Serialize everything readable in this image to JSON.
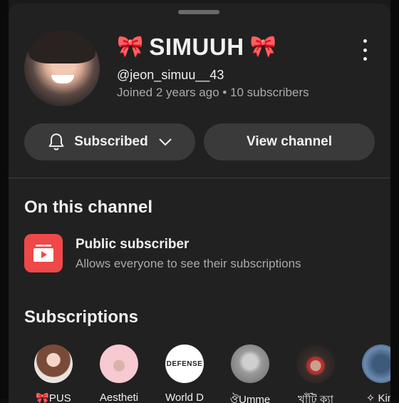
{
  "channel": {
    "bow_glyph": "🎀",
    "name": "SIMUUH",
    "handle": "@jeon_simuu__43",
    "meta": "Joined 2 years ago • 10 subscribers"
  },
  "buttons": {
    "subscribed": "Subscribed",
    "view_channel": "View channel"
  },
  "on_this_channel": {
    "title": "On this channel",
    "item_title": "Public subscriber",
    "item_desc": "Allows everyone to see their subscriptions"
  },
  "subscriptions": {
    "title": "Subscriptions",
    "items": [
      {
        "name": "🎀PUS"
      },
      {
        "name": "Aestheti"
      },
      {
        "name": "World D"
      },
      {
        "name": "ঔUmme"
      },
      {
        "name": "খাঁটি ক্যা"
      },
      {
        "name": "✧ Kim"
      }
    ],
    "defense_logo_text": "DEFENSE"
  },
  "colors": {
    "background": "#212121",
    "accent_red": "#f04848",
    "pill": "#3a3a3a",
    "muted_text": "#aaaaaa"
  }
}
